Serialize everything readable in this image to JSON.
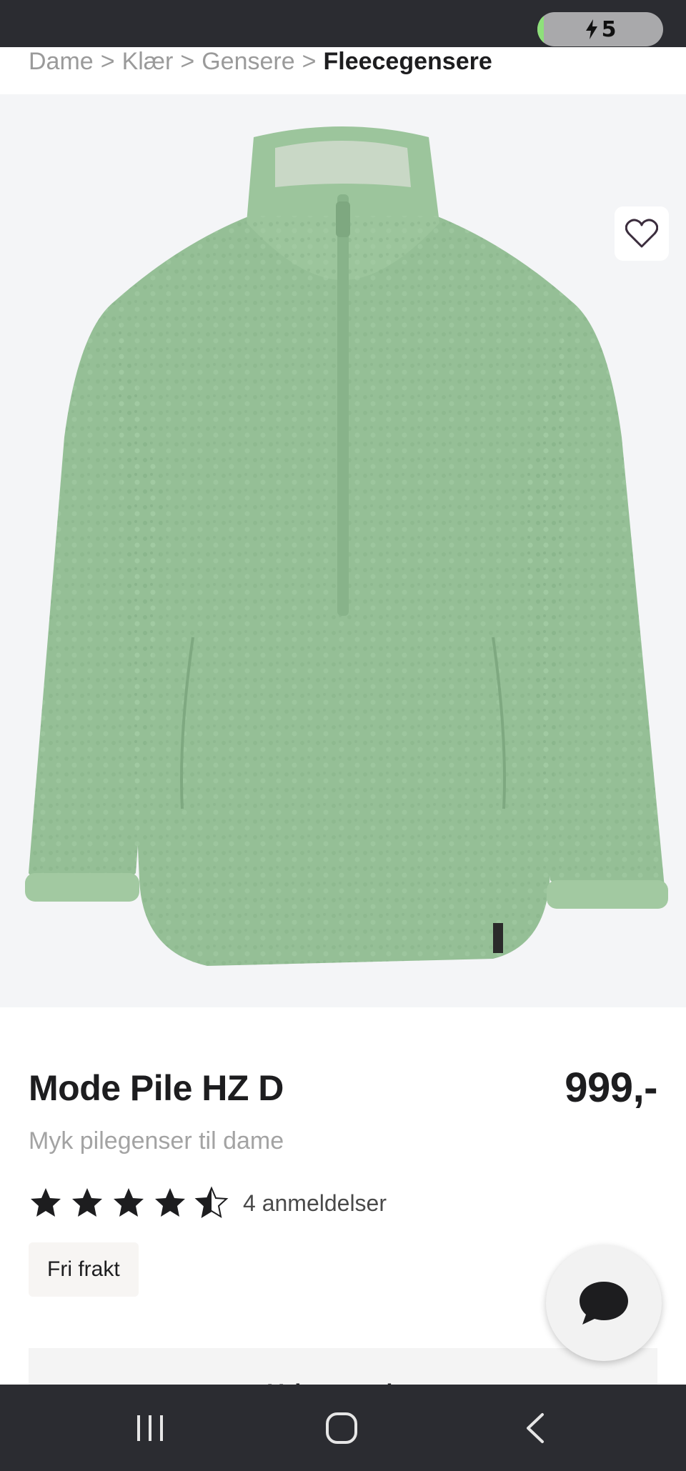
{
  "status_bar": {
    "battery_level": "5",
    "battery_fill_fraction": 0.05
  },
  "breadcrumb": {
    "items": [
      "Dame",
      "Klær",
      "Gensere"
    ],
    "separator": ">",
    "current": "Fleecegensere"
  },
  "product": {
    "title": "Mode Pile HZ D",
    "price": "999,-",
    "subtitle": "Myk pilegenser til dame",
    "rating_stars": 4.5,
    "rating_max": 5,
    "reviews_label": "4 anmeldelser",
    "shipping_badge": "Fri frakt",
    "size_select_label": "Velg størrelse",
    "image_color": "#95bf96"
  },
  "nav_bar": {
    "recent_icon": "recent-apps-icon",
    "home_icon": "home-icon",
    "back_icon": "back-icon"
  }
}
